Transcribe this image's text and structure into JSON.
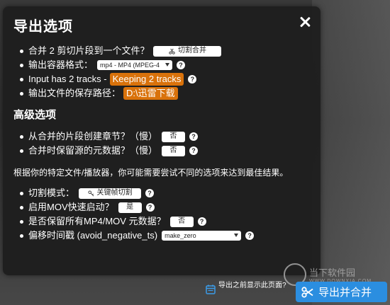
{
  "dialog": {
    "title": "导出选项",
    "basic": [
      {
        "text": "合并 2 剪切片段到一个文件？",
        "control": {
          "kind": "button",
          "label": "切割合并",
          "icon": "scissor-icon"
        }
      },
      {
        "text": "输出容器格式：",
        "control": {
          "kind": "select",
          "value": "mp4 - MP4 (MPEG-4"
        }
      },
      {
        "text": "Input has 2 tracks - ",
        "highlight": "Keeping 2 tracks"
      },
      {
        "text": "输出文件的保存路径：",
        "highlight": "D:\\迅雷下载"
      }
    ],
    "advanced_title": "高级选项",
    "advanced": [
      {
        "text": "从合并的片段创建章节？（慢）",
        "control": {
          "kind": "button",
          "label": "否"
        }
      },
      {
        "text": "合并时保留源的元数据？（慢）",
        "control": {
          "kind": "button",
          "label": "否"
        }
      }
    ],
    "note": "根据你的特定文件/播放器，你可能需要尝试不同的选项来达到最佳结果。",
    "more": [
      {
        "text": "切割模式：",
        "control": {
          "kind": "button",
          "label": "关键帧切割",
          "icon": "key-icon"
        }
      },
      {
        "text": "启用MOV快速启动？",
        "control": {
          "kind": "button",
          "label": "是"
        }
      },
      {
        "text": "是否保留所有MP4/MOV 元数据？",
        "control": {
          "kind": "button",
          "label": "否"
        }
      },
      {
        "text": "偏移时间戳 (avoid_negative_ts)",
        "control": {
          "kind": "select",
          "value": "make_zero"
        }
      }
    ],
    "help_glyph": "?"
  },
  "footer": {
    "show_before_text": "导出之前显示此页面?",
    "export_label": "导出并合并"
  },
  "watermark": {
    "text": "当下软件园",
    "sub": "WWW.DOWNXIA.COM"
  },
  "colors": {
    "accent": "#d9720b",
    "export": "#2b8ee0"
  }
}
